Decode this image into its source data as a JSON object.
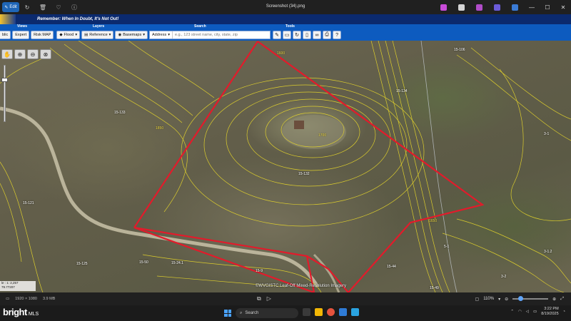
{
  "window": {
    "edit_label": "Edit",
    "file_title": "Screenshot (34).png",
    "controls": [
      "minimize-icon",
      "maximize-icon",
      "close-icon"
    ]
  },
  "banner": {
    "tagline": "Remember: When In Doubt, It's Not Out!"
  },
  "toolbar": {
    "sections": {
      "views": "Views",
      "layers": "Layers",
      "search": "Search",
      "tools": "Tools"
    },
    "public_label": "blic",
    "expert_label": "Expert",
    "riskmap_label": "Risk MAP",
    "flood_label": "Flood",
    "reference_label": "Reference",
    "basemaps_label": "Basemaps",
    "address_select": "Address",
    "address_placeholder": "e.g., 123 street name, city, state, zip"
  },
  "map": {
    "parcel_labels": [
      "15-106",
      "15-134",
      "15-133",
      "15-132",
      "15-121",
      "15-50",
      "15-44",
      "15-49",
      "3-1",
      "3-1.2",
      "3-2",
      "5-1",
      "15-125",
      "15-24.1",
      "15-9"
    ],
    "contour_labels": [
      "1600",
      "1700",
      "1850",
      "1650",
      "1500",
      "1700"
    ],
    "scale_text": "le : 1: 2,257",
    "coords_text": "79.77207",
    "attribution": "©WVGISTC Leaf-Off Mixed-Resolution Imagery",
    "colors": {
      "parcel_boundary": "#e21b2b",
      "contour": "#e8d82a",
      "road": "#c9c2a8"
    }
  },
  "statusbar": {
    "dimensions": "1920 × 1080",
    "file_size": "3.9 MB",
    "zoom": "110%"
  },
  "taskbar": {
    "brand": "bright",
    "brand_sub": "MLS",
    "search_label": "Search",
    "time": "3:22 PM",
    "date": "8/19/2025"
  }
}
